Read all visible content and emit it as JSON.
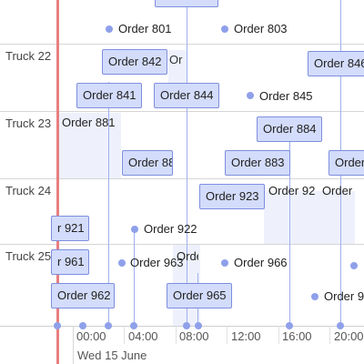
{
  "timeline": {
    "resources": [
      "Truck 22",
      "Truck 23",
      "Truck 24",
      "Truck 25"
    ],
    "date_label": "Wed 15 June",
    "time_ticks": [
      "00:00",
      "04:00",
      "08:00",
      "12:00",
      "16:00",
      "20:00"
    ]
  },
  "events": {
    "order_801": "Order 801",
    "order_803": "Order 803",
    "order_842": "Order 842",
    "order_846": "Order 846",
    "order_841": "Order 841",
    "order_844": "Order 844",
    "order_845": "Order 845",
    "order_881": "Order 881",
    "order_884": "Order 884",
    "order_88x": "Order 88",
    "order_883": "Order 883",
    "order_88r": "Order",
    "order_923": "Order 923",
    "order_92x": "Order 92",
    "order_92r": "Order",
    "order_921": "r 921",
    "order_922": "Order 922",
    "order_961": "r 961",
    "order_963": "Order 963",
    "order_96x": "Orde",
    "order_966": "Order 966",
    "order_962": "Order 962",
    "order_965": "Order 965",
    "order_9xx": "Order 9"
  },
  "colors": {
    "accent": "#7e8ee0",
    "event_fill": "#d3dcfa",
    "now_line": "#e87f7f",
    "shade": "#eef1fc"
  }
}
